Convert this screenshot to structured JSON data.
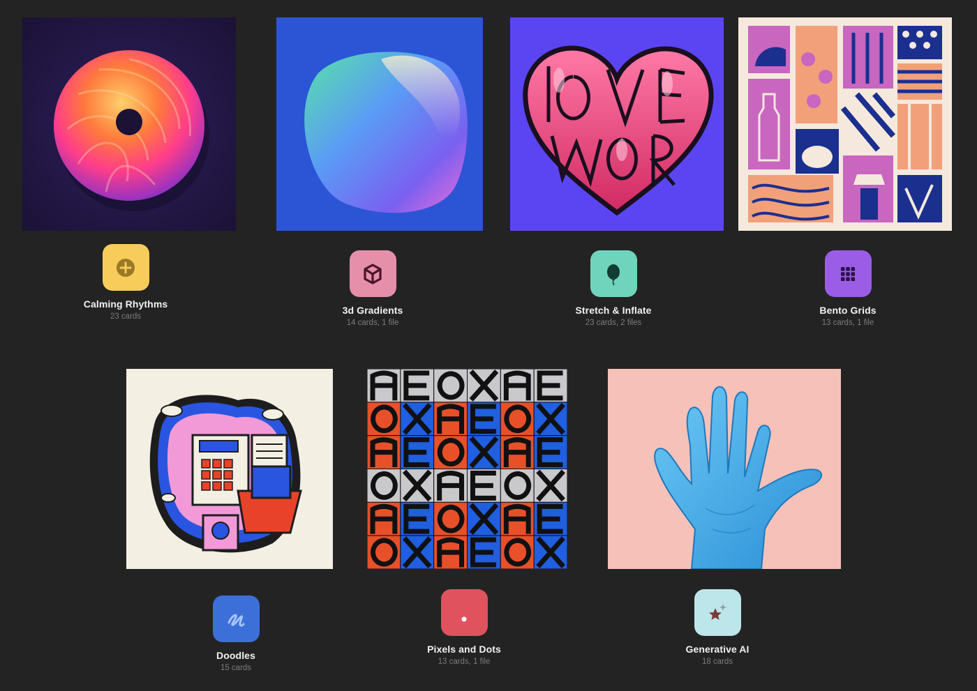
{
  "collections": [
    {
      "title": "Calming Rhythms",
      "meta": "23 cards",
      "icon": "plus-icon",
      "icon_bg": "#f7cc5b",
      "image": "swirl-donut-image"
    },
    {
      "title": "3d Gradients",
      "meta": "14 cards, 1 file",
      "icon": "cube-icon",
      "icon_bg": "#e58fab",
      "image": "gradient-blob-image"
    },
    {
      "title": "Stretch & Inflate",
      "meta": "23 cards, 2 files",
      "icon": "balloon-icon",
      "icon_bg": "#6fd4bb",
      "image": "love-more-heart-image"
    },
    {
      "title": "Bento Grids",
      "meta": "13 cards, 1 file",
      "icon": "grid-icon",
      "icon_bg": "#9b5de5",
      "image": "bento-collage-image"
    },
    {
      "title": "Doodles",
      "meta": "15 cards",
      "icon": "scribble-icon",
      "icon_bg": "#3c6fd8",
      "image": "doodle-illustration-image"
    },
    {
      "title": "Pixels and Dots",
      "meta": "13 cards, 1 file",
      "icon": "dot-icon",
      "icon_bg": "#e0525e",
      "image": "type-specimen-grid-image"
    },
    {
      "title": "Generative AI",
      "meta": "18 cards",
      "icon": "sparkle-star-icon",
      "icon_bg": "#bde6ea",
      "image": "blue-glove-hand-image"
    }
  ],
  "colors": {
    "background": "#232323",
    "title_text": "#f2f2f2",
    "meta_text": "#7d7d7d"
  }
}
